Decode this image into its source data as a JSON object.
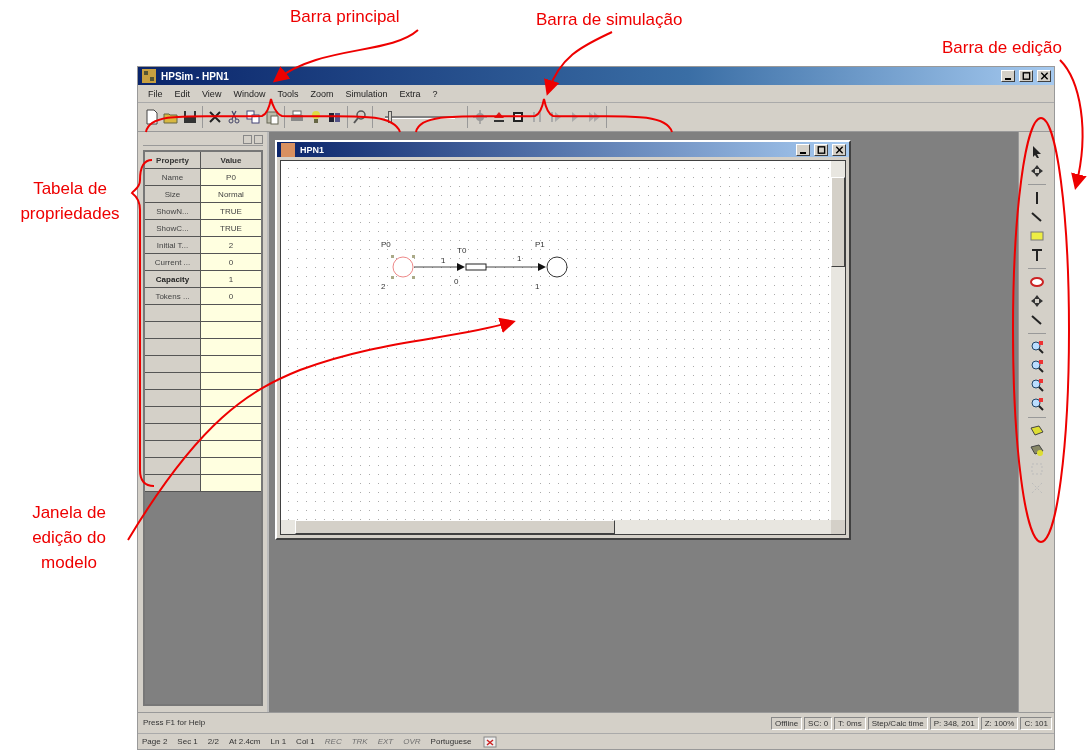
{
  "annotations": [
    {
      "kind": "main",
      "text": "Barra principal"
    },
    {
      "kind": "simulation",
      "text": "Barra de simulação"
    },
    {
      "kind": "editing",
      "text": "Barra de edição"
    },
    {
      "kind": "properties",
      "text": "Tabela de propriedades"
    },
    {
      "kind": "model",
      "text": "Janela de edição do modelo"
    }
  ],
  "app": {
    "title": "HPSim - HPN1",
    "menu": [
      "File",
      "Edit",
      "View",
      "Window",
      "Tools",
      "Zoom",
      "Simulation",
      "Extra",
      "?"
    ],
    "speed_slider": {
      "level": 0.05
    },
    "property_table": {
      "columns": [
        "Property",
        "Value"
      ],
      "rows": [
        {
          "property": "Name",
          "value": "P0",
          "bold": false
        },
        {
          "property": "Size",
          "value": "Normal",
          "bold": false
        },
        {
          "property": "ShowN...",
          "value": "TRUE",
          "bold": false
        },
        {
          "property": "ShowC...",
          "value": "TRUE",
          "bold": false
        },
        {
          "property": "Initial T...",
          "value": "2",
          "bold": false
        },
        {
          "property": "Current ...",
          "value": "0",
          "bold": false
        },
        {
          "property": "Capacity",
          "value": "1",
          "bold": true
        },
        {
          "property": "Tokens ...",
          "value": "0",
          "bold": false
        }
      ]
    },
    "model_window": {
      "title": "HPN1",
      "places": [
        {
          "label": "P0",
          "tokens": "2",
          "selected": true
        },
        {
          "label": "P1",
          "tokens": "1",
          "selected": false
        }
      ],
      "transition": {
        "label": "T0",
        "value": "0"
      },
      "arcs": [
        {
          "weight": "1"
        },
        {
          "weight": "1"
        }
      ]
    },
    "status_bar": [
      "Press F1 for Help",
      "Offline",
      "SC: 0",
      "T: 0ms",
      "Step/Calc time",
      "P: 348, 201",
      "Z: 100%",
      "C: 101"
    ]
  },
  "word_status_bar": [
    {
      "text": "Page 2",
      "disabled": false
    },
    {
      "text": "Sec 1",
      "disabled": false
    },
    {
      "text": "2/2",
      "disabled": false
    },
    {
      "text": "At 2.4cm",
      "disabled": false
    },
    {
      "text": "Ln 1",
      "disabled": false
    },
    {
      "text": "Col 1",
      "disabled": false
    },
    {
      "text": "REC",
      "disabled": true
    },
    {
      "text": "TRK",
      "disabled": true
    },
    {
      "text": "EXT",
      "disabled": true
    },
    {
      "text": "OVR",
      "disabled": true
    },
    {
      "text": "Portuguese",
      "disabled": false
    }
  ]
}
